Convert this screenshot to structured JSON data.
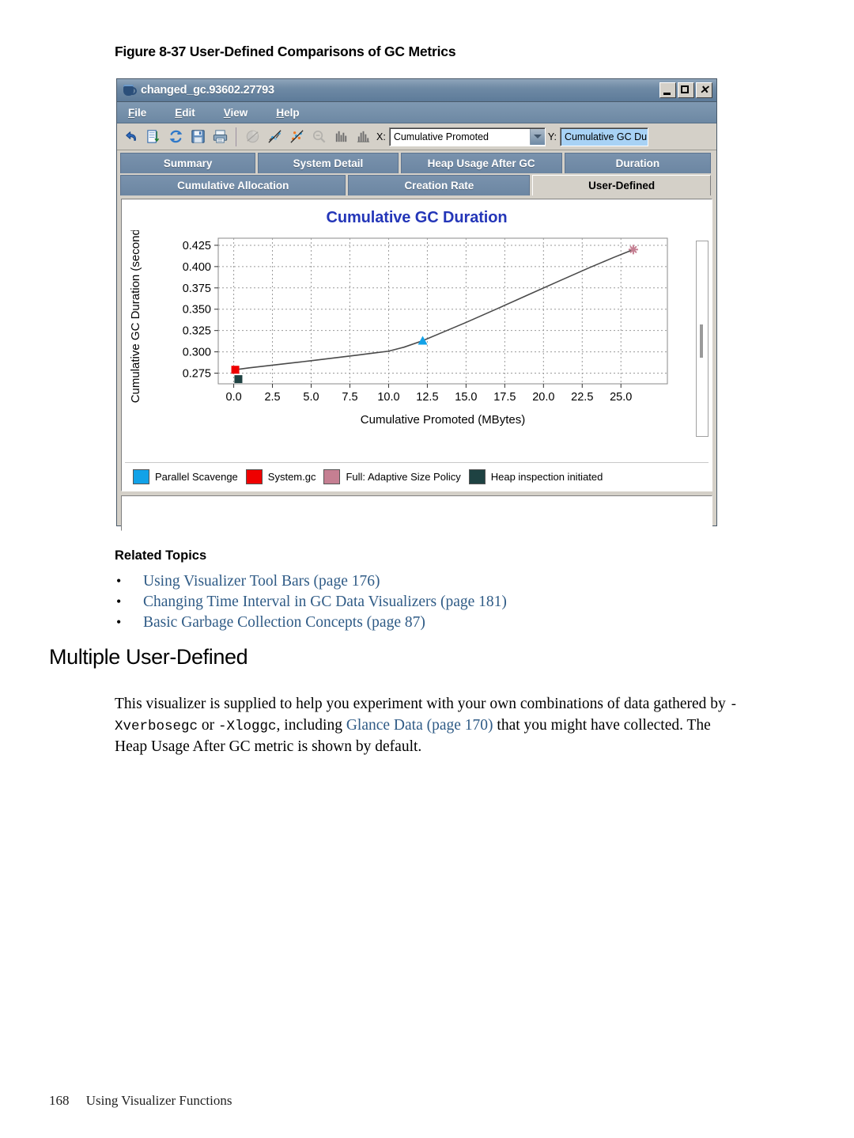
{
  "figure": {
    "number": "Figure 8-37",
    "caption": "User-Defined Comparisons of GC Metrics"
  },
  "window": {
    "title": "changed_gc.93602.27793",
    "icon": "java-cup-icon",
    "controls": {
      "minimize": "_",
      "maximize": "□",
      "close": "×"
    },
    "menu": [
      "File",
      "Edit",
      "View",
      "Help"
    ],
    "toolbar": {
      "buttons": [
        "undo-icon",
        "document-exchange-icon",
        "refresh-icon",
        "save-icon",
        "print-icon",
        "pie-chart-icon",
        "line-chart-icon",
        "scatter-chart-icon",
        "zoom-out-icon",
        "bar-chart-icon",
        "histogram-icon"
      ],
      "x_label": "X:",
      "x_value": "Cumulative Promoted",
      "y_label": "Y:",
      "y_value": "Cumulative GC Du"
    },
    "tabs_row1": [
      "Summary",
      "System Detail",
      "Heap Usage After GC",
      "Duration"
    ],
    "tabs_row2": [
      "Cumulative Allocation",
      "Creation Rate",
      "User-Defined"
    ],
    "active_tab": "User-Defined"
  },
  "chart_data": {
    "type": "line",
    "title": "Cumulative GC Duration",
    "xlabel": "Cumulative Promoted  (MBytes)",
    "ylabel": "Cumulative GC Duration  (seconds)",
    "xlim": [
      -1.0,
      28.0
    ],
    "ylim": [
      0.2625,
      0.4333
    ],
    "xticks": [
      "0.0",
      "2.5",
      "5.0",
      "7.5",
      "10.0",
      "12.5",
      "15.0",
      "17.5",
      "20.0",
      "22.5",
      "25.0"
    ],
    "xtick_values": [
      0.0,
      2.5,
      5.0,
      7.5,
      10.0,
      12.5,
      15.0,
      17.5,
      20.0,
      22.5,
      25.0
    ],
    "yticks": [
      "0.425",
      "0.400",
      "0.375",
      "0.350",
      "0.325",
      "0.300",
      "0.275"
    ],
    "ytick_values": [
      0.425,
      0.4,
      0.375,
      0.35,
      0.325,
      0.3,
      0.275
    ],
    "grid": true,
    "legend_position": "bottom",
    "line_color": "#4a4a4a",
    "series": [
      {
        "name": "Cumulative GC Duration",
        "x": [
          0.1,
          1.0,
          2.0,
          3.0,
          4.0,
          5.0,
          6.0,
          7.0,
          8.0,
          9.0,
          10.0,
          11.0,
          12.2,
          13.5,
          15.0,
          17.0,
          19.0,
          21.0,
          23.0,
          24.5,
          25.8
        ],
        "y": [
          0.279,
          0.2812,
          0.2833,
          0.2854,
          0.2875,
          0.2896,
          0.2918,
          0.294,
          0.2962,
          0.2985,
          0.3008,
          0.3055,
          0.3131,
          0.323,
          0.3345,
          0.3505,
          0.3668,
          0.383,
          0.399,
          0.4105,
          0.42
        ]
      }
    ],
    "markers": [
      {
        "label": "System.gc",
        "x": 0.1,
        "y": 0.279,
        "color": "#ef0000",
        "shape": "square"
      },
      {
        "label": "Heap inspection initiated",
        "x": 0.3,
        "y": 0.268,
        "color": "#1e4242",
        "shape": "square"
      },
      {
        "label": "Parallel Scavenge",
        "x": 12.2,
        "y": 0.3131,
        "color": "#12a2e8",
        "shape": "triangle"
      },
      {
        "label": "Full: Adaptive Size Policy",
        "x": 25.8,
        "y": 0.42,
        "color": "#c57f92",
        "shape": "star"
      }
    ],
    "legend": [
      {
        "label": "Parallel Scavenge",
        "color": "#12a2e8"
      },
      {
        "label": "System.gc",
        "color": "#ef0000"
      },
      {
        "label": "Full: Adaptive Size Policy",
        "color": "#c57f92"
      },
      {
        "label": "Heap inspection initiated",
        "color": "#1e4242"
      }
    ]
  },
  "related": {
    "heading": "Related Topics",
    "items": [
      "Using Visualizer Tool Bars (page 176)",
      "Changing Time Interval in GC Data Visualizers (page 181)",
      "Basic Garbage Collection Concepts (page 87)"
    ]
  },
  "section": {
    "heading": "Multiple User-Defined",
    "para_part1": "This visualizer is supplied to help you experiment with your own combinations of data gathered by ",
    "para_mono1": "-Xverbosegc",
    "para_part2": " or ",
    "para_mono2": "-Xloggc",
    "para_part3": ", including ",
    "para_link": "Glance Data (page 170)",
    "para_part4": " that you might have collected. The Heap Usage After GC metric is shown by default."
  },
  "footer": {
    "page": "168",
    "text": "Using Visualizer Functions"
  }
}
